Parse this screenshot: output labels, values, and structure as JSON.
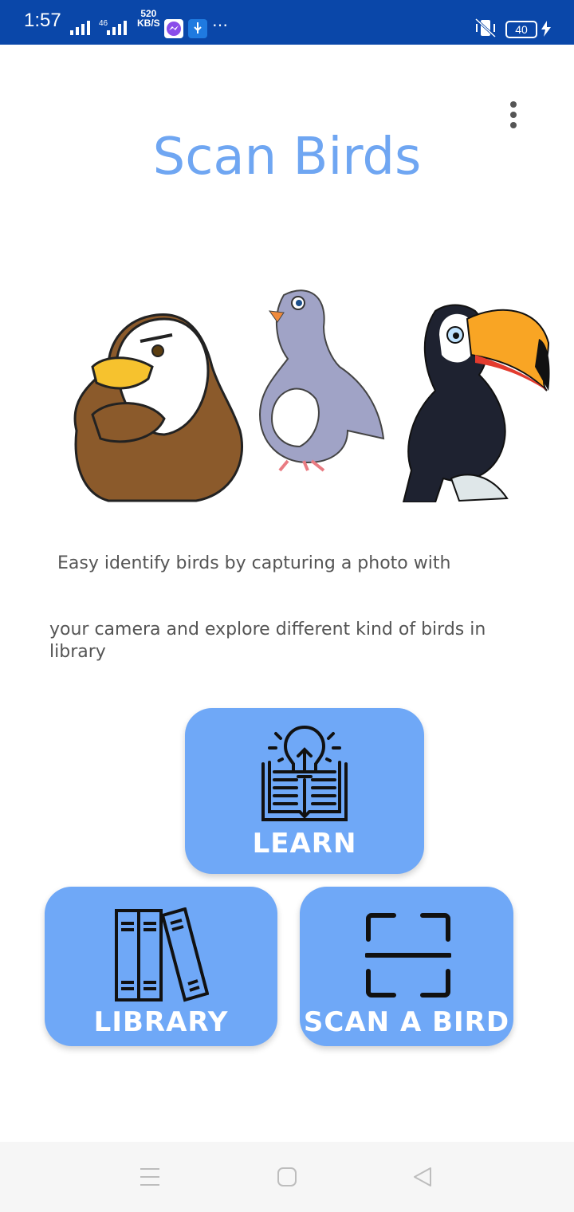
{
  "status_bar": {
    "time": "1:57",
    "network": "46",
    "net_rate": "520",
    "net_unit": "KB/S",
    "battery": "40"
  },
  "app": {
    "title": "Scan Birds",
    "description_line1": "Easy identify birds by capturing a photo with",
    "description_line2": "your camera and explore different kind of birds in library"
  },
  "buttons": {
    "learn": "LEARN",
    "library": "LIBRARY",
    "scan": "SCAN A BIRD"
  },
  "colors": {
    "accent": "#6fa8f7",
    "statusbar": "#0a47a9"
  },
  "icons": [
    "menu-dots-icon",
    "lightbulb-book-icon",
    "books-icon",
    "scan-frame-icon"
  ]
}
